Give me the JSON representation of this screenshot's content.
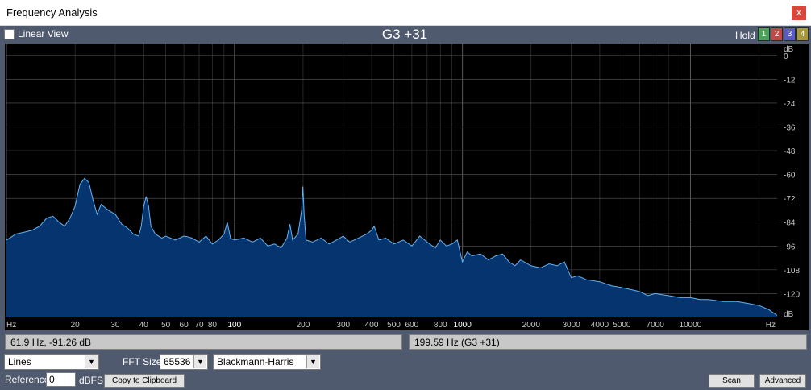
{
  "window": {
    "title": "Frequency Analysis",
    "close_label": "x"
  },
  "toolbar": {
    "linear_view_label": "Linear View",
    "note_readout": "G3 +31",
    "hold_label": "Hold",
    "hold_buttons": [
      {
        "label": "1",
        "color": "#4aa35a"
      },
      {
        "label": "2",
        "color": "#c24848"
      },
      {
        "label": "3",
        "color": "#5a5ac8"
      },
      {
        "label": "4",
        "color": "#a89a3a"
      }
    ]
  },
  "colors": {
    "spectrum_fill": "#05346e",
    "spectrum_line": "#63b4f4",
    "grid": "#5a5a5a",
    "plot_bg": "#000000"
  },
  "chart_data": {
    "type": "area",
    "xscale": "log",
    "xlim": [
      10,
      24000
    ],
    "ylim": [
      -132,
      6
    ],
    "x_unit_label": "Hz",
    "y_unit_label": "dB",
    "x_ticks": [
      {
        "value": 20,
        "label": "20"
      },
      {
        "value": 30,
        "label": "30"
      },
      {
        "value": 40,
        "label": "40"
      },
      {
        "value": 50,
        "label": "50"
      },
      {
        "value": 60,
        "label": "60"
      },
      {
        "value": 70,
        "label": "70"
      },
      {
        "value": 80,
        "label": "80"
      },
      {
        "value": 100,
        "label": "100"
      },
      {
        "value": 200,
        "label": "200"
      },
      {
        "value": 300,
        "label": "300"
      },
      {
        "value": 400,
        "label": "400"
      },
      {
        "value": 500,
        "label": "500"
      },
      {
        "value": 600,
        "label": "600"
      },
      {
        "value": 800,
        "label": "800"
      },
      {
        "value": 1000,
        "label": "1000"
      },
      {
        "value": 2000,
        "label": "2000"
      },
      {
        "value": 3000,
        "label": "3000"
      },
      {
        "value": 4000,
        "label": "4000"
      },
      {
        "value": 5000,
        "label": "5000"
      },
      {
        "value": 7000,
        "label": "7000"
      },
      {
        "value": 10000,
        "label": "10000"
      }
    ],
    "y_ticks": [
      0,
      -12,
      -24,
      -36,
      -48,
      -60,
      -72,
      -84,
      -96,
      -108,
      -120
    ],
    "series": [
      {
        "points": [
          [
            10,
            -93
          ],
          [
            11,
            -90
          ],
          [
            12,
            -89
          ],
          [
            13,
            -88
          ],
          [
            14,
            -86
          ],
          [
            15,
            -82
          ],
          [
            16,
            -81
          ],
          [
            17,
            -84
          ],
          [
            18,
            -86
          ],
          [
            19,
            -82
          ],
          [
            20,
            -76
          ],
          [
            21,
            -65
          ],
          [
            22,
            -62
          ],
          [
            23,
            -64
          ],
          [
            24,
            -73
          ],
          [
            25,
            -80
          ],
          [
            26,
            -75
          ],
          [
            28,
            -78
          ],
          [
            30,
            -80
          ],
          [
            32,
            -85
          ],
          [
            34,
            -87
          ],
          [
            36,
            -90
          ],
          [
            38,
            -91
          ],
          [
            39,
            -86
          ],
          [
            40,
            -76
          ],
          [
            41,
            -71
          ],
          [
            42,
            -76
          ],
          [
            43,
            -86
          ],
          [
            45,
            -90
          ],
          [
            48,
            -92
          ],
          [
            50,
            -91
          ],
          [
            55,
            -93
          ],
          [
            60,
            -91
          ],
          [
            61.9,
            -91.3
          ],
          [
            65,
            -92
          ],
          [
            70,
            -94
          ],
          [
            75,
            -91
          ],
          [
            80,
            -95
          ],
          [
            85,
            -93
          ],
          [
            90,
            -90
          ],
          [
            93,
            -84
          ],
          [
            96,
            -92
          ],
          [
            100,
            -93
          ],
          [
            110,
            -92
          ],
          [
            120,
            -94
          ],
          [
            130,
            -92
          ],
          [
            140,
            -96
          ],
          [
            150,
            -95
          ],
          [
            160,
            -97
          ],
          [
            170,
            -92
          ],
          [
            175,
            -85
          ],
          [
            180,
            -93
          ],
          [
            190,
            -90
          ],
          [
            197,
            -78
          ],
          [
            199.6,
            -66
          ],
          [
            202,
            -80
          ],
          [
            206,
            -93
          ],
          [
            220,
            -94
          ],
          [
            240,
            -92
          ],
          [
            260,
            -95
          ],
          [
            280,
            -93
          ],
          [
            300,
            -91
          ],
          [
            320,
            -94
          ],
          [
            350,
            -92
          ],
          [
            380,
            -90
          ],
          [
            400,
            -88
          ],
          [
            410,
            -86
          ],
          [
            430,
            -93
          ],
          [
            460,
            -92
          ],
          [
            500,
            -95
          ],
          [
            550,
            -93
          ],
          [
            600,
            -96
          ],
          [
            650,
            -91
          ],
          [
            700,
            -94
          ],
          [
            760,
            -97
          ],
          [
            800,
            -93
          ],
          [
            850,
            -96
          ],
          [
            900,
            -95
          ],
          [
            950,
            -93
          ],
          [
            1000,
            -104
          ],
          [
            1050,
            -99
          ],
          [
            1100,
            -101
          ],
          [
            1200,
            -100
          ],
          [
            1300,
            -103
          ],
          [
            1400,
            -101
          ],
          [
            1500,
            -100
          ],
          [
            1600,
            -104
          ],
          [
            1700,
            -106
          ],
          [
            1800,
            -103
          ],
          [
            2000,
            -106
          ],
          [
            2200,
            -107
          ],
          [
            2400,
            -105
          ],
          [
            2600,
            -106
          ],
          [
            2800,
            -104
          ],
          [
            3000,
            -112
          ],
          [
            3200,
            -111
          ],
          [
            3500,
            -113
          ],
          [
            4000,
            -114
          ],
          [
            4500,
            -116
          ],
          [
            5000,
            -117
          ],
          [
            5500,
            -118
          ],
          [
            6000,
            -119
          ],
          [
            6500,
            -121
          ],
          [
            7000,
            -120
          ],
          [
            8000,
            -121
          ],
          [
            9000,
            -122
          ],
          [
            10000,
            -122
          ],
          [
            11000,
            -123
          ],
          [
            12000,
            -123
          ],
          [
            14000,
            -124
          ],
          [
            16000,
            -124
          ],
          [
            18000,
            -125
          ],
          [
            20000,
            -126
          ],
          [
            22000,
            -128
          ],
          [
            24000,
            -131
          ]
        ]
      }
    ]
  },
  "status": {
    "cursor_readout": "61.9 Hz, -91.26 dB",
    "peak_readout": "199.59 Hz (G3 +31)"
  },
  "controls": {
    "display_mode": "Lines",
    "fft_size_label": "FFT Size",
    "fft_size": "65536",
    "window_function": "Blackmann-Harris",
    "reference_label": "Reference",
    "reference_value": "0",
    "reference_unit": "dBFS",
    "copy_label": "Copy to Clipboard",
    "scan_label": "Scan",
    "advanced_label": "Advanced"
  }
}
